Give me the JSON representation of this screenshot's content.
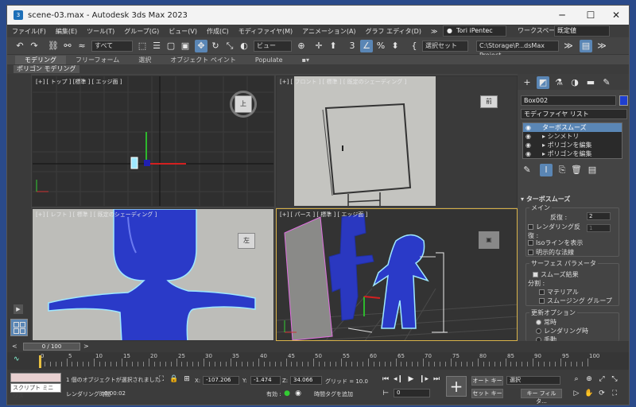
{
  "window": {
    "title": "scene-03.max - Autodesk 3ds Max 2023",
    "minimize": "─",
    "maximize": "☐",
    "close": "✕",
    "icon": "3ds-max-icon"
  },
  "menu": [
    "ファイル(F)",
    "編集(E)",
    "ツール(T)",
    "グループ(G)",
    "ビュー(V)",
    "作成(C)",
    "モディファイヤ(M)",
    "アニメーション(A)",
    "グラフ エディタ(D)",
    "≫"
  ],
  "user": {
    "name": "Tori iPentec",
    "workspace_label": "ワークスペース:",
    "workspace_value": "既定値"
  },
  "toolbar": {
    "filter": "すべて",
    "ref_coord": "ビュー",
    "selection_set": "選択セット",
    "project_path": "C:\\Storage\\P...dsMax Project"
  },
  "ribbon": {
    "tabs": [
      "モデリング",
      "フリーフォーム",
      "選択",
      "オブジェクト ペイント",
      "Populate"
    ],
    "sub": "ポリゴン モデリング"
  },
  "viewports": {
    "top": {
      "label": "[+] [ トップ ] [標準 ] [ エッジ面 ]",
      "cube": "上"
    },
    "front": {
      "label": "[+] [ フロント ] [ 標準 ] [ 既定のシェーディング ]",
      "cube": "前"
    },
    "left": {
      "label": "[+] [ レフト ] [ 標準 ] [ 既定のシェーディング ]",
      "cube": "左"
    },
    "persp": {
      "label": "[+] [ パース ] [ 標準 ] [ エッジ面 ]"
    }
  },
  "cmd": {
    "object_name": "Box002",
    "modifier_list": "モディファイヤ リスト",
    "stack": [
      "ターボスムーズ",
      "シンメトリ",
      "ポリゴンを編集",
      "ポリゴンを編集"
    ],
    "rollout": "ターボスムーズ",
    "main": "メイン",
    "iterations_label": "反復 :",
    "iterations": "2",
    "render_iter_label": "レンダリング反復 :",
    "render_iter": "1",
    "isoline": "Isoラインを表示",
    "explicit_normals": "明示的な法線",
    "surface_group": "サーフェス パラメータ",
    "smooth_result": "スムーズ結果",
    "separate": "分割 :",
    "materials": "マテリアル",
    "smoothing_groups": "スムージング グループ",
    "update_group": "更新オプション",
    "always": "常時",
    "when_rendering": "レンダリング時",
    "manually": "手動"
  },
  "time": {
    "slider": "0 / 100",
    "ticks": [
      "0",
      "5",
      "10",
      "15",
      "20",
      "25",
      "30",
      "35",
      "40",
      "45",
      "50",
      "55",
      "60",
      "65",
      "70",
      "75",
      "80",
      "85",
      "90",
      "95",
      "100"
    ],
    "progress": 0.0
  },
  "status": {
    "maxscript": "スクリプト ミニ リス",
    "selected": "1 個のオブジェクトが選択されました",
    "render_time_label": "レンダリング時間",
    "render_time": "0:00:02",
    "x_label": "X:",
    "x": "-107.206",
    "y_label": "Y:",
    "y": "-1.474",
    "z_label": "Z:",
    "z": "34.066",
    "grid": "グリッド = 10.0",
    "enabled": "有効 :",
    "add_time_tag": "時間タグを追加",
    "auto_key": "オート キー",
    "set_key": "セット キー",
    "selection": "選択",
    "key_filters": "キー フィルタ...",
    "frame": "0"
  }
}
